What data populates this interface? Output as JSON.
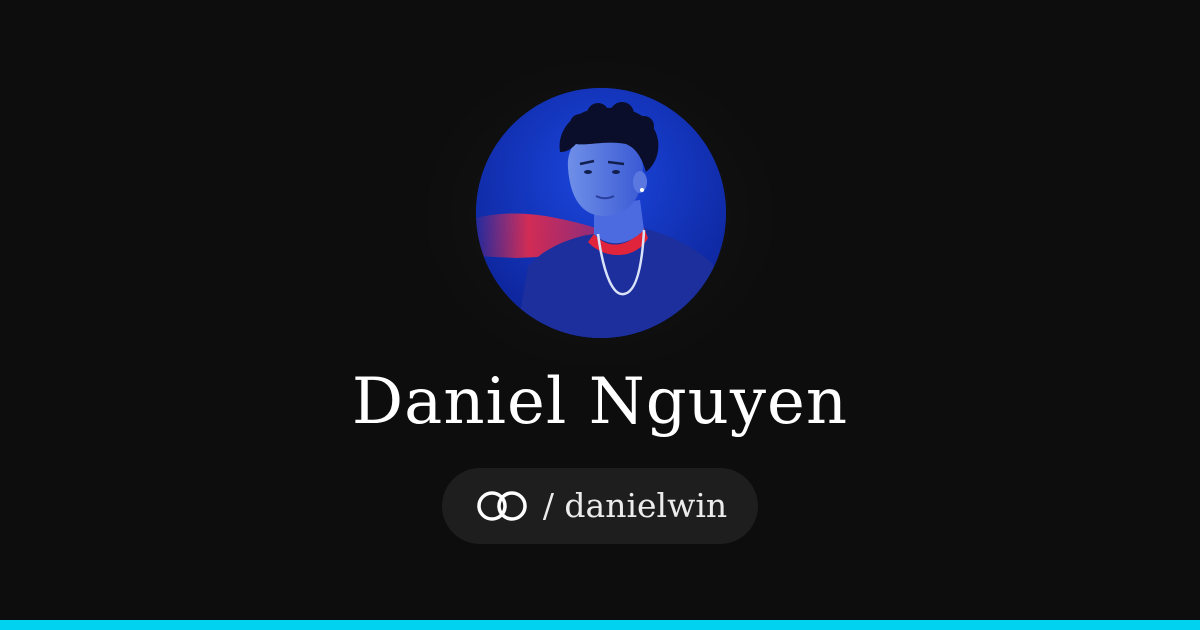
{
  "profile": {
    "name": "Daniel Nguyen",
    "handle": "/ danielwin"
  },
  "icons": {
    "logo": "interlocking-rings-icon",
    "avatar": "profile-photo"
  },
  "colors": {
    "background": "#0d0d0d",
    "pill": "#1e1e1e",
    "accent": "#00d2ef",
    "text": "#ffffff"
  }
}
